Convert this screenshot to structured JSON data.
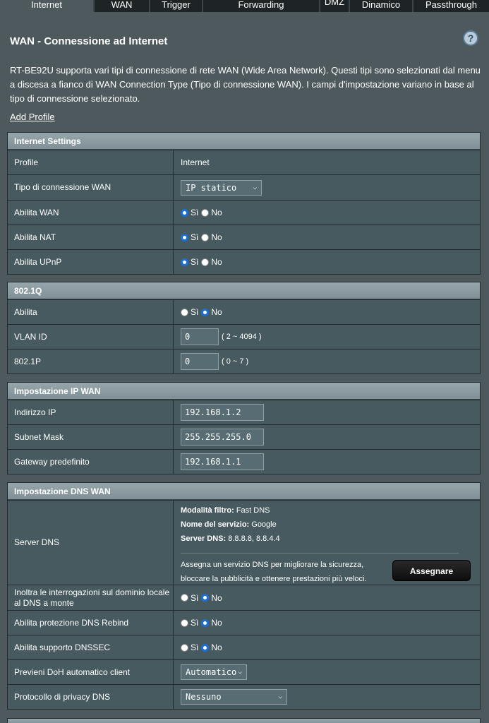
{
  "tabs": [
    "Internet",
    "WAN",
    "Trigger",
    "Forwarding",
    "DMZ",
    "Dinamico",
    "Passthrough"
  ],
  "page_title": "WAN - Connessione ad Internet",
  "help_icon": "?",
  "intro": "RT-BE92U supporta vari tipi di connessione di rete WAN (Wide Area Network). Questi tipi sono selezionati dal menu a discesa a fianco di WAN Connection Type (Tipo di connessione WAN). I campi d'impostazione variano in base al tipo di connessione selezionato.",
  "add_profile": "Add Profile",
  "internet": {
    "header": "Internet Settings",
    "profile_label": "Profile",
    "profile_value": "Internet",
    "wan_type_label": "Tipo di connessione WAN",
    "wan_type_value": "IP statico",
    "enable_wan_label": "Abilita WAN",
    "enable_nat_label": "Abilita NAT",
    "enable_upnp_label": "Abilita UPnP"
  },
  "radio": {
    "yes": "Sì",
    "no": "No"
  },
  "dot1q": {
    "header": "802.1Q",
    "enable_label": "Abilita",
    "vlan_label": "VLAN ID",
    "vlan_value": "0",
    "vlan_hint": "( 2 ~ 4094 )",
    "p_label": "802.1P",
    "p_value": "0",
    "p_hint": "( 0 ~ 7 )"
  },
  "ip": {
    "header": "Impostazione IP WAN",
    "addr_label": "Indirizzo IP",
    "addr_value": "192.168.1.2",
    "mask_label": "Subnet Mask",
    "mask_value": "255.255.255.0",
    "gw_label": "Gateway predefinito",
    "gw_value": "192.168.1.1"
  },
  "dns": {
    "header": "Impostazione DNS WAN",
    "server_label": "Server DNS",
    "filter_key": "Modalità filtro:",
    "filter_val": " Fast DNS",
    "service_key": "Nome del servizio:",
    "service_val": " Google",
    "servers_key": "Server DNS:",
    "servers_val": " 8.8.8.8, 8.8.4.4",
    "desc": "Assegna un servizio DNS per migliorare la sicurezza, bloccare la pubblicità e ottenere prestazioni più veloci.",
    "assign_label": "Assegnare",
    "forward_label": "Inoltra le interrogazioni sul dominio locale al DNS a monte",
    "rebind_label": "Abilita protezione DNS Rebind",
    "dnssec_label": "Abilita supporto DNSSEC",
    "doh_label": "Previeni DoH automatico client",
    "doh_value": "Automatico",
    "privacy_label": "Protocollo di privacy DNS",
    "privacy_value": "Nessuno"
  }
}
